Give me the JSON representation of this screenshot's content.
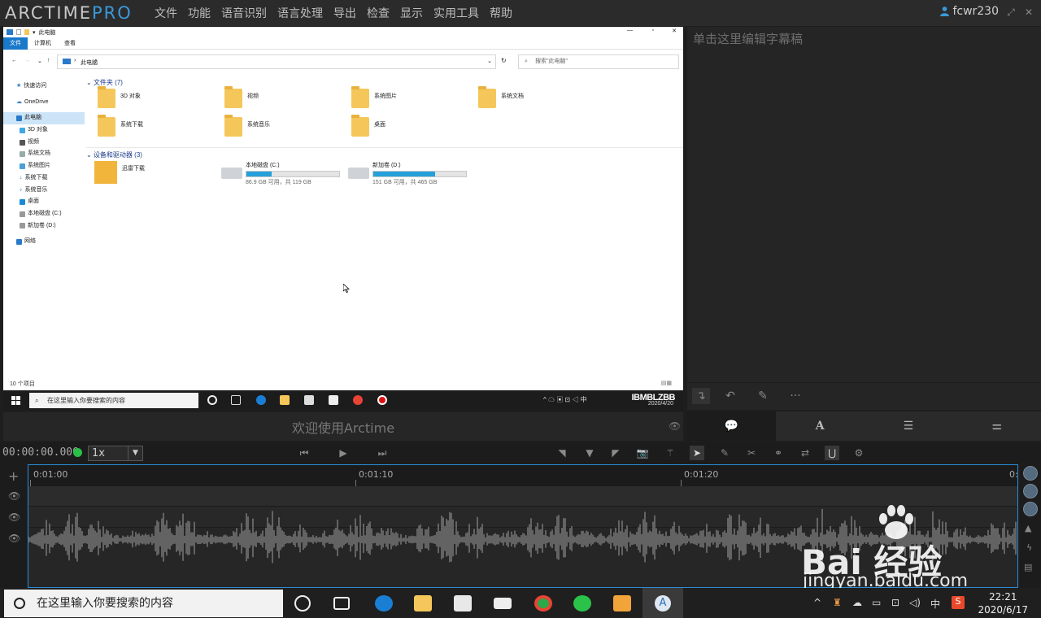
{
  "app": {
    "logo_main": "ARCTIME",
    "logo_pro": "PRO",
    "menu": [
      "文件",
      "功能",
      "语音识别",
      "语言处理",
      "导出",
      "检查",
      "显示",
      "实用工具",
      "帮助"
    ],
    "user": "fcwr230"
  },
  "explorer": {
    "window_title": "此电脑",
    "ribbon_tabs": [
      "文件",
      "计算机",
      "查看"
    ],
    "address": "此电脑",
    "search_placeholder": "搜索\"此电脑\"",
    "nav": [
      {
        "label": "快速访问",
        "sub": false
      },
      {
        "label": "OneDrive",
        "sub": false
      },
      {
        "label": "此电脑",
        "sub": false,
        "selected": true
      },
      {
        "label": "3D 对象",
        "sub": true
      },
      {
        "label": "视频",
        "sub": true
      },
      {
        "label": "系统文档",
        "sub": true
      },
      {
        "label": "系统图片",
        "sub": true
      },
      {
        "label": "系统下载",
        "sub": true
      },
      {
        "label": "系统音乐",
        "sub": true
      },
      {
        "label": "桌面",
        "sub": true
      },
      {
        "label": "本地磁盘 (C:)",
        "sub": true
      },
      {
        "label": "新加卷 (D:)",
        "sub": true
      },
      {
        "label": "网络",
        "sub": false
      }
    ],
    "folders_header": "文件夹 (7)",
    "folders": [
      "3D 对象",
      "视频",
      "系统图片",
      "系统文档",
      "系统下载",
      "系统音乐",
      "桌面"
    ],
    "devices_header": "设备和驱动器 (3)",
    "devices": [
      {
        "label": "迅雷下载",
        "kind": "app"
      },
      {
        "label": "本地磁盘 (C:)",
        "detail": "86.9 GB 可用，共 119 GB",
        "used_fraction": 0.27
      },
      {
        "label": "新加卷 (D:)",
        "detail": "151 GB 可用，共 465 GB",
        "used_fraction": 0.67
      }
    ],
    "status": "10 个项目",
    "taskbar_search": "在这里输入你要搜索的内容",
    "brand": "IBMBLZBB",
    "date": "2020/4/20"
  },
  "editor": {
    "placeholder": "单击这里编辑字幕稿"
  },
  "welcome": "欢迎使用Arctime",
  "controls": {
    "timecode": "00:00:00.000",
    "speed": "1x"
  },
  "timeline": {
    "ticks": [
      "0:01:00",
      "0:01:10",
      "0:01:20",
      "0:"
    ]
  },
  "watermark": {
    "main": "Bai 经验",
    "sub": "jingyan.baidu.com"
  },
  "taskbar": {
    "search_placeholder": "在这里输入你要搜索的内容",
    "tray_lang": "中",
    "time": "22:21",
    "date": "2020/6/17"
  },
  "colors": {
    "accent": "#2a8bd8",
    "drive_fill": "#26a0da",
    "folder": "#f5c75a"
  }
}
